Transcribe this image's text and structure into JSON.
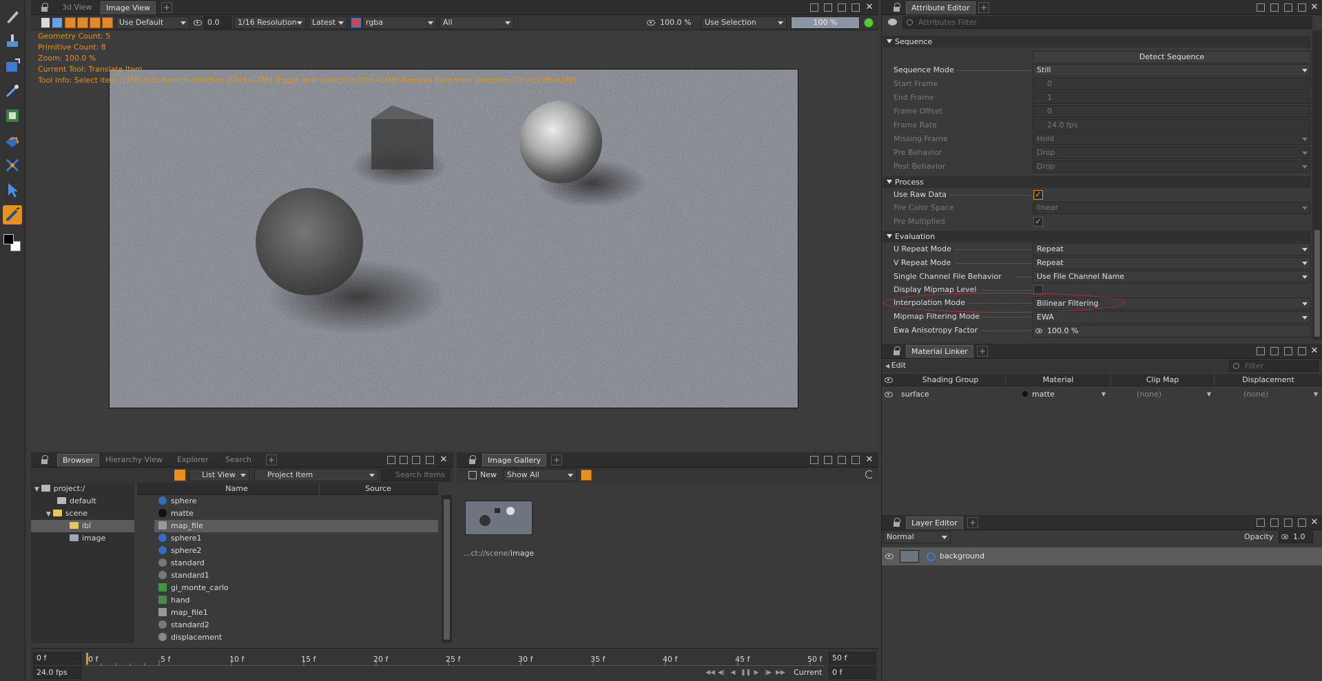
{
  "left_toolbar": {
    "tools": [
      "brush-tool",
      "paint-tool",
      "transform-tool",
      "eyedropper-tool",
      "mask-tool",
      "projection-tool",
      "transform-gizmo-tool",
      "select-tool",
      "paint-brush-tool"
    ]
  },
  "viewer": {
    "tabs": [
      "3d View",
      "Image View"
    ],
    "toolbar": {
      "display_mode": "Use Default",
      "exposure": "0.0",
      "resolution": "1/16 Resolution",
      "version": "Latest",
      "channels": "rgba",
      "filter": "All",
      "zoom": "100.0 %",
      "selection": "Use Selection",
      "progress": "100 %",
      "progress_value": 1.0
    },
    "overlay": [
      "Geometry Count: 5",
      "Primitive Count: 8",
      "Zoom: 100.0 %",
      "Current Tool: Translate Item",
      "Tool Info: Select item (LMB)  Add item to selection (Shift+LMB)  Toggle item selection (Ctrl+LMB)  Remove item from selection (Ctrl+Shift+LMB)"
    ]
  },
  "attribute_editor": {
    "tab": "Attribute Editor",
    "filter_placeholder": "Attributes Filter",
    "sections": {
      "sequence": {
        "title": "Sequence",
        "detect_button": "Detect Sequence",
        "rows": [
          {
            "label": "Sequence Mode",
            "value": "Still"
          },
          {
            "label": "Start Frame",
            "value": "0"
          },
          {
            "label": "End Frame",
            "value": "1"
          },
          {
            "label": "Frame Offset",
            "value": "0"
          },
          {
            "label": "Frame Rate",
            "value": "24.0 fps"
          },
          {
            "label": "Missing Frame",
            "value": "Hold"
          },
          {
            "label": "Pre Behavior",
            "value": "Drop"
          },
          {
            "label": "Post Behavior",
            "value": "Drop"
          }
        ]
      },
      "process": {
        "title": "Process",
        "rows": [
          {
            "label": "Use Raw Data",
            "value": "✓"
          },
          {
            "label": "File Color Space",
            "value": "linear"
          },
          {
            "label": "Pre Multiplied",
            "value": "✓"
          }
        ]
      },
      "evaluation": {
        "title": "Evaluation",
        "rows": [
          {
            "label": "U Repeat Mode",
            "value": "Repeat"
          },
          {
            "label": "V Repeat Mode",
            "value": "Repeat"
          },
          {
            "label": "Single Channel File Behavior",
            "value": "Use File Channel Name"
          },
          {
            "label": "Display Mipmap Level",
            "value": ""
          },
          {
            "label": "Interpolation Mode",
            "value": "Bilinear Filtering"
          },
          {
            "label": "Mipmap Filtering Mode",
            "value": "EWA"
          },
          {
            "label": "Ewa Anisotropy Factor",
            "value": "100.0 %"
          }
        ]
      }
    }
  },
  "material_linker": {
    "tab": "Material Linker",
    "edit_menu": "Edit",
    "filter_placeholder": "Filter",
    "columns": [
      "Shading Group",
      "Material",
      "Clip Map",
      "Displacement"
    ],
    "rows": [
      {
        "shading_group": "surface",
        "material": "matte",
        "clip_map": "(none)",
        "displacement": "(none)"
      }
    ]
  },
  "browser": {
    "tabs": [
      "Browser",
      "Hierarchy View",
      "Explorer",
      "Search"
    ],
    "view_mode": "List View",
    "filter": "Project Item",
    "search_placeholder": "Search Items",
    "tree": [
      "project:/",
      "default",
      "scene",
      "ibl",
      "image"
    ],
    "columns": [
      "Name",
      "Source"
    ],
    "items": [
      "sphere",
      "matte",
      "map_file",
      "sphere1",
      "sphere2",
      "standard",
      "standard1",
      "gi_monte_carlo",
      "hand",
      "map_file1",
      "standard2",
      "displacement"
    ]
  },
  "gallery": {
    "tab": "Image Gallery",
    "new_label": "New",
    "filter": "Show All",
    "caption_prefix": "...ct://scene/",
    "caption_name": "image"
  },
  "layer_editor": {
    "tab": "Layer Editor",
    "blend": "Normal",
    "opacity_label": "Opacity",
    "opacity": "1.0",
    "layers": [
      {
        "name": "background"
      }
    ]
  },
  "timeline": {
    "start": "0 f",
    "end": "50 f",
    "fps": "24.0 fps",
    "current_label": "Current",
    "current": "0 f",
    "ticks": [
      "0 f",
      "5 f",
      "10 f",
      "15 f",
      "20 f",
      "25 f",
      "30 f",
      "35 f",
      "40 f",
      "45 f",
      "50 f"
    ]
  }
}
